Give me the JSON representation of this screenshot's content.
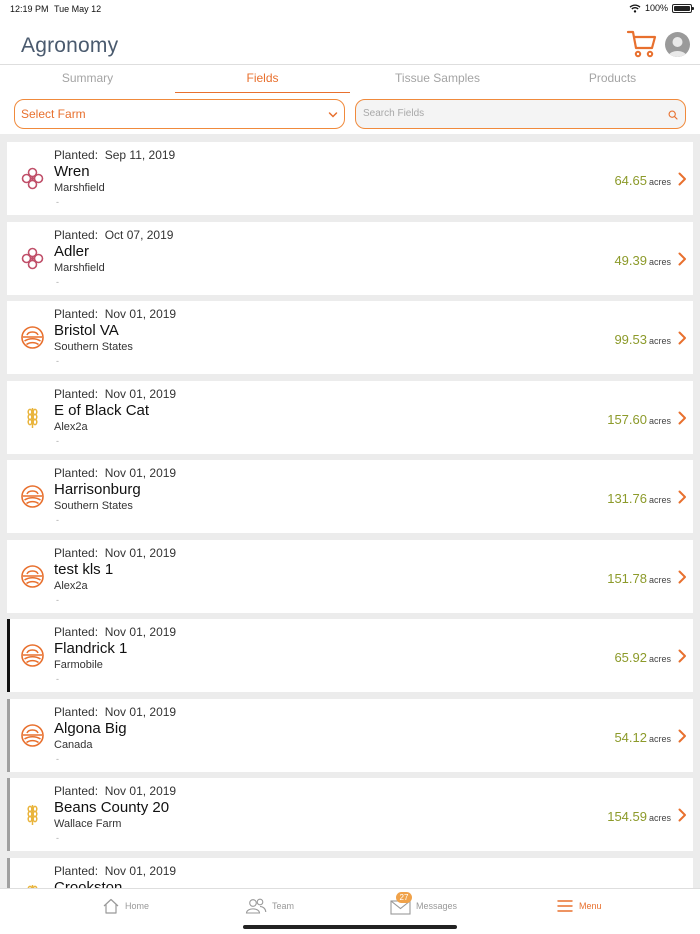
{
  "status_bar": {
    "time": "12:19 PM",
    "date": "Tue May 12",
    "battery": "100%"
  },
  "app": {
    "title": "Agronomy"
  },
  "tabs": [
    {
      "label": "Summary",
      "active": false
    },
    {
      "label": "Fields",
      "active": true
    },
    {
      "label": "Tissue Samples",
      "active": false
    },
    {
      "label": "Products",
      "active": false
    }
  ],
  "filters": {
    "farm_select_label": "Select Farm",
    "search_placeholder": "Search Fields",
    "search_value": ""
  },
  "colors": {
    "accent": "#e8702e",
    "acres": "#8c9a2a",
    "flower_icon": "#c0506a",
    "grain_icon": "#e9b43c"
  },
  "fields": [
    {
      "planted_label": "Planted:",
      "planted_date": "Sep 11, 2019",
      "name": "Wren",
      "farm": "Marshfield",
      "note": "-",
      "acres": "64.65",
      "unit": "acres",
      "icon": "flower-icon",
      "marker": "none"
    },
    {
      "planted_label": "Planted:",
      "planted_date": "Oct 07, 2019",
      "name": "Adler",
      "farm": "Marshfield",
      "note": "-",
      "acres": "49.39",
      "unit": "acres",
      "icon": "flower-icon",
      "marker": "none"
    },
    {
      "planted_label": "Planted:",
      "planted_date": "Nov 01, 2019",
      "name": "Bristol VA",
      "farm": "Southern States",
      "note": "-",
      "acres": "99.53",
      "unit": "acres",
      "icon": "field-sun-icon",
      "marker": "none"
    },
    {
      "planted_label": "Planted:",
      "planted_date": "Nov 01, 2019",
      "name": "E of Black Cat",
      "farm": "Alex2a",
      "note": "-",
      "acres": "157.60",
      "unit": "acres",
      "icon": "wheat-icon",
      "marker": "none"
    },
    {
      "planted_label": "Planted:",
      "planted_date": "Nov 01, 2019",
      "name": "Harrisonburg",
      "farm": "Southern States",
      "note": "-",
      "acres": "131.76",
      "unit": "acres",
      "icon": "field-sun-icon",
      "marker": "none"
    },
    {
      "planted_label": "Planted:",
      "planted_date": "Nov 01, 2019",
      "name": "test kls 1",
      "farm": "Alex2a",
      "note": "-",
      "acres": "151.78",
      "unit": "acres",
      "icon": "field-sun-icon",
      "marker": "none"
    },
    {
      "planted_label": "Planted:",
      "planted_date": "Nov 01, 2019",
      "name": "Flandrick 1",
      "farm": "Farmobile",
      "note": "-",
      "acres": "65.92",
      "unit": "acres",
      "icon": "field-sun-icon",
      "marker": "black"
    },
    {
      "planted_label": "Planted:",
      "planted_date": "Nov 01, 2019",
      "name": "Algona Big",
      "farm": "Canada",
      "note": "-",
      "acres": "54.12",
      "unit": "acres",
      "icon": "field-sun-icon",
      "marker": "gray"
    },
    {
      "planted_label": "Planted:",
      "planted_date": "Nov 01, 2019",
      "name": "Beans County 20",
      "farm": "Wallace Farm",
      "note": "-",
      "acres": "154.59",
      "unit": "acres",
      "icon": "wheat-icon",
      "marker": "gray"
    },
    {
      "planted_label": "Planted:",
      "planted_date": "Nov 01, 2019",
      "name": "Crookston",
      "farm": "",
      "note": "",
      "acres": "",
      "unit": "",
      "icon": "wheat-icon",
      "marker": "gray"
    }
  ],
  "bottom_nav": [
    {
      "label": "Home",
      "icon": "home-icon",
      "active": false
    },
    {
      "label": "Team",
      "icon": "team-icon",
      "active": false
    },
    {
      "label": "Messages",
      "icon": "envelope-icon",
      "badge": "27",
      "active": false
    },
    {
      "label": "Menu",
      "icon": "menu-icon",
      "active": true
    }
  ]
}
